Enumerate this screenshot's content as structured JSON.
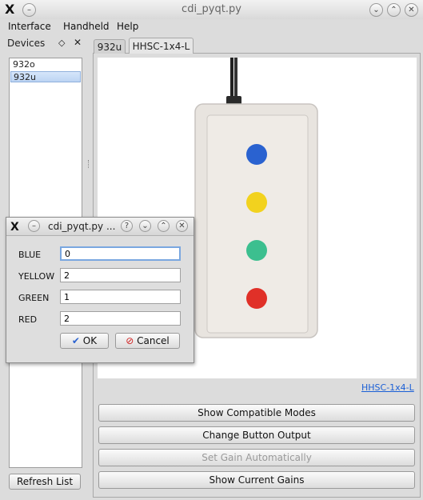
{
  "window": {
    "title": "cdi_pyqt.py"
  },
  "menu": {
    "items": [
      "Interface",
      "Handheld",
      "Help"
    ]
  },
  "devices_dock": {
    "title": "Devices",
    "items": [
      "932o",
      "932u"
    ],
    "selected_index": 1,
    "refresh_label": "Refresh List"
  },
  "tabs": {
    "items": [
      "932u",
      "HHSC-1x4-L"
    ],
    "active_index": 1
  },
  "device_panel": {
    "link_label": "HHSC-1x4-L",
    "buttons": [
      {
        "label": "Show Compatible Modes",
        "enabled": true
      },
      {
        "label": "Change Button Output",
        "enabled": true
      },
      {
        "label": "Set Gain Automatically",
        "enabled": false
      },
      {
        "label": "Show Current Gains",
        "enabled": true
      }
    ],
    "device_image": {
      "led_colors": [
        "#2a62d0",
        "#f2d21e",
        "#3cbf8f",
        "#e03028"
      ]
    }
  },
  "dialog": {
    "title": "cdi_pyqt.py ...",
    "fields": [
      {
        "label": "BLUE",
        "value": "0"
      },
      {
        "label": "YELLOW",
        "value": "2"
      },
      {
        "label": "GREEN",
        "value": "1"
      },
      {
        "label": "RED",
        "value": "2"
      }
    ],
    "ok_label": "OK",
    "cancel_label": "Cancel"
  },
  "colors": {
    "link": "#1a5fd6",
    "selection": "#bcd4f3",
    "focus": "#7aa7e0"
  }
}
